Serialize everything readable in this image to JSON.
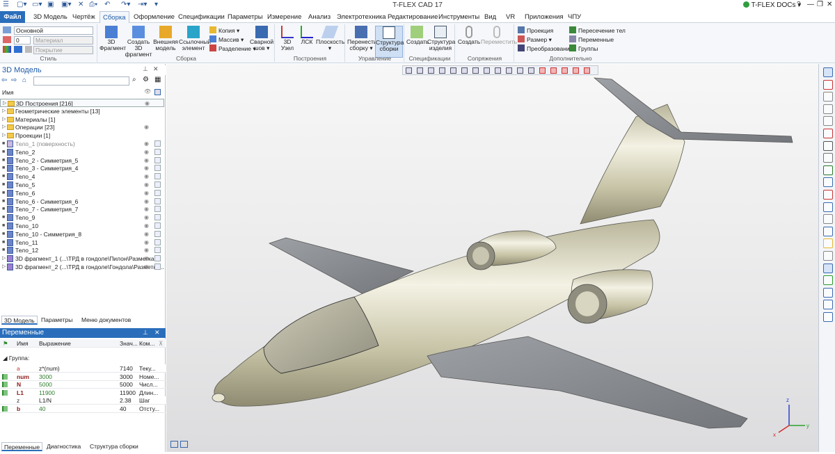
{
  "app": {
    "title": "T-FLEX CAD 17",
    "docs_label": "T-FLEX DOCs"
  },
  "menu": [
    "Файл",
    "3D Модель",
    "Чертёж",
    "Сборка",
    "Оформление",
    "Спецификации",
    "Параметры",
    "Измерение",
    "Анализ",
    "Электротехника",
    "Редактирование",
    "Инструменты",
    "Вид",
    "VR",
    "Приложения",
    "ЧПУ"
  ],
  "ribbon": {
    "style": {
      "name": "Стиль",
      "layer": "Основной",
      "num": "0",
      "material": "Материал",
      "cover": "Покрытие"
    },
    "assembly": {
      "name": "Сборка",
      "btn1": "3D",
      "btn1b": "Фрагмент",
      "btn2": "Создать 3D",
      "btn2b": "фрагмент",
      "btn3": "Внешняя",
      "btn3b": "модель",
      "btn4": "Ссылочный",
      "btn4b": "элемент",
      "copy": "Копия",
      "array": "Массив",
      "split": "Разделение",
      "weld": "Сварной",
      "weldb": "шов"
    },
    "build": {
      "name": "Построения",
      "node": "3D",
      "nodeb": "Узел",
      "lsk": "ЛСК",
      "plane": "Плоскость"
    },
    "control": {
      "name": "Управление",
      "move": "Перенести",
      "moveb": "сборку",
      "struct": "Структура",
      "structb": "сборки"
    },
    "spec": {
      "name": "Спецификации",
      "create": "Создать",
      "prod": "Структура",
      "prodb": "изделия"
    },
    "mates": {
      "name": "Сопряжения",
      "create": "Создать",
      "move": "Переместить"
    },
    "extra": {
      "name": "Дополнительно",
      "proj": "Проекция",
      "size": "Размер",
      "transform": "Преобразование",
      "intersect": "Пересечение тел",
      "vars": "Переменные",
      "groups": "Группы"
    }
  },
  "model_panel": {
    "title": "3D Модель",
    "col_name": "Имя",
    "tree": [
      {
        "label": "3D Построения [216]",
        "kind": "folder"
      },
      {
        "label": "Геометрические элементы [13]",
        "kind": "folder"
      },
      {
        "label": "Материалы [1]",
        "kind": "folder"
      },
      {
        "label": "Операции [23]",
        "kind": "folder"
      },
      {
        "label": "Проекции [1]",
        "kind": "folder"
      },
      {
        "label": "Тело_1 (поверхность)",
        "kind": "body-dim"
      },
      {
        "label": "Тело_2",
        "kind": "body"
      },
      {
        "label": "Тело_2 - Симметрия_5",
        "kind": "body"
      },
      {
        "label": "Тело_3 - Симметрия_4",
        "kind": "body"
      },
      {
        "label": "Тело_4",
        "kind": "body"
      },
      {
        "label": "Тело_5",
        "kind": "body"
      },
      {
        "label": "Тело_6",
        "kind": "body"
      },
      {
        "label": "Тело_6 - Симметрия_6",
        "kind": "body"
      },
      {
        "label": "Тело_7 - Симметрия_7",
        "kind": "body"
      },
      {
        "label": "Тело_9",
        "kind": "body"
      },
      {
        "label": "Тело_10",
        "kind": "body"
      },
      {
        "label": "Тело_10 - Симметрия_8",
        "kind": "body"
      },
      {
        "label": "Тело_11",
        "kind": "body"
      },
      {
        "label": "Тело_12",
        "kind": "body"
      },
      {
        "label": "3D фрагмент_1 (...\\ТРД в гондоле\\Пилон\\Разметка ...",
        "kind": "frag"
      },
      {
        "label": "3D фрагмент_2 (...\\ТРД в гондоле\\Гондола\\Разметка...",
        "kind": "frag"
      }
    ],
    "tabs": [
      "3D Модель",
      "Параметры",
      "Меню документов"
    ]
  },
  "vars_panel": {
    "title": "Переменные",
    "headers": [
      "Имя",
      "Выражение",
      "Знач...",
      "Ком..."
    ],
    "group": "Группа:",
    "rows": [
      {
        "name": "a",
        "expr": "z*(num)",
        "val": "7140",
        "comment": "Теку..."
      },
      {
        "name": "num",
        "expr": "3000",
        "val": "3000",
        "comment": "Номе..."
      },
      {
        "name": "N",
        "expr": "5000",
        "val": "5000",
        "comment": "Числ..."
      },
      {
        "name": "L1",
        "expr": "11900",
        "val": "11900",
        "comment": "Длин..."
      },
      {
        "name": "z",
        "expr": "L1/N",
        "val": "2.38",
        "comment": "Шаг"
      },
      {
        "name": "b",
        "expr": "40",
        "val": "40",
        "comment": "Отсту..."
      }
    ],
    "tabs": [
      "Переменные",
      "Диагностика",
      "Структура сборки"
    ]
  },
  "colors": {
    "accent": "#2a6ebb",
    "body": "#d3cfb4",
    "wing": "#8e9195"
  }
}
